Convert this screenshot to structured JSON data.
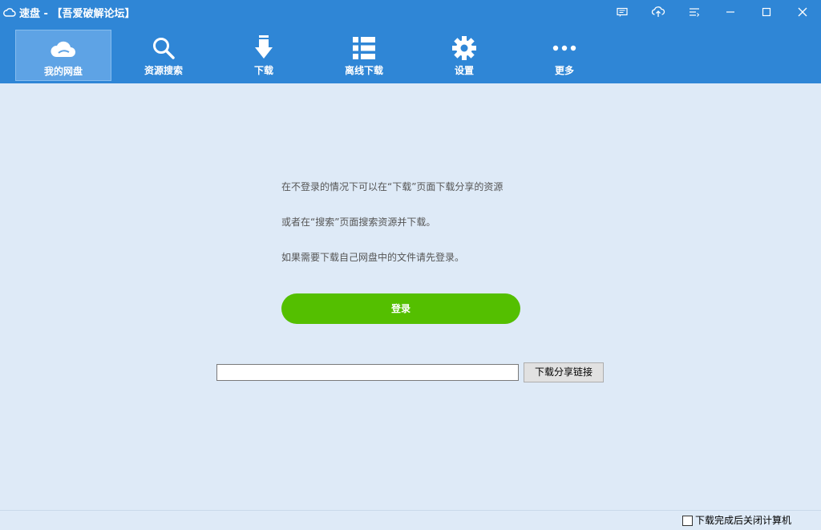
{
  "window": {
    "app_name": "速盘 - 【吾爱破解论坛】",
    "icons": [
      "cloud-icon",
      "message-icon",
      "cloud-upload-icon",
      "menu-icon",
      "minimize-icon",
      "maximize-icon",
      "close-icon"
    ]
  },
  "toolbar": {
    "items": [
      {
        "label": "我的网盘",
        "icon": "cloud-icon",
        "active": true
      },
      {
        "label": "资源搜索",
        "icon": "search-icon",
        "active": false
      },
      {
        "label": "下载",
        "icon": "download-arrow-icon",
        "active": false
      },
      {
        "label": "离线下载",
        "icon": "list-icon",
        "active": false
      },
      {
        "label": "设置",
        "icon": "gear-icon",
        "active": false
      },
      {
        "label": "更多",
        "icon": "more-dots-icon",
        "active": false
      }
    ]
  },
  "main": {
    "lines": [
      "在不登录的情况下可以在“下载”页面下载分享的资源",
      "或者在“搜索”页面搜索资源并下载。",
      "如果需要下载自己网盘中的文件请先登录。"
    ],
    "login_label": "登录",
    "share_link_value": "",
    "share_link_button": "下载分享链接"
  },
  "statusbar": {
    "shutdown_label": "下载完成后关闭计算机",
    "shutdown_checked": false
  },
  "colors": {
    "titlebar": "#2f86d6",
    "active_tab": "#5ea3e5",
    "background": "#deeaf7",
    "login_button": "#54bf00"
  }
}
